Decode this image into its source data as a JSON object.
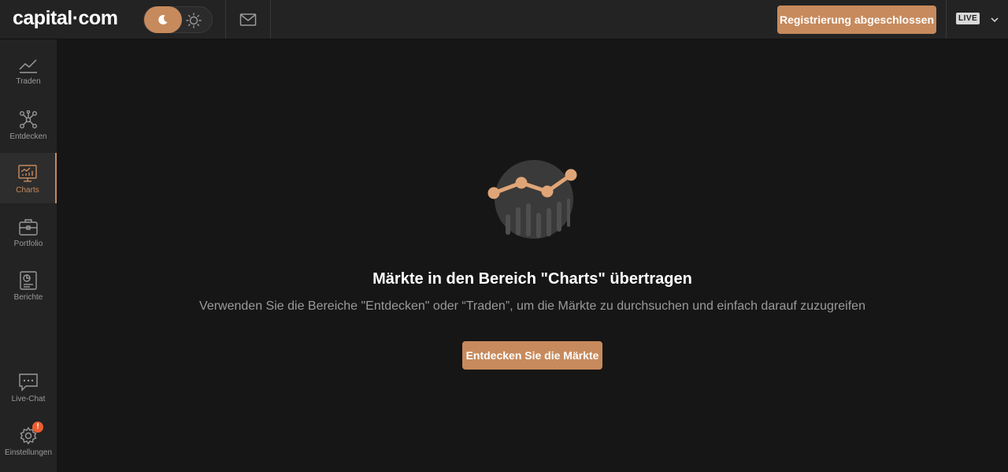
{
  "header": {
    "logo": "capital·com",
    "register_label": "Registrierung abgeschlossen",
    "account_mode": "LIVE"
  },
  "sidebar": {
    "items": [
      {
        "label": "Traden",
        "icon": "trend-icon"
      },
      {
        "label": "Entdecken",
        "icon": "network-icon"
      },
      {
        "label": "Charts",
        "icon": "chart-monitor-icon",
        "active": true
      },
      {
        "label": "Portfolio",
        "icon": "briefcase-icon"
      },
      {
        "label": "Berichte",
        "icon": "report-icon"
      },
      {
        "label": "Live-Chat",
        "icon": "chat-icon"
      },
      {
        "label": "Einstellungen",
        "icon": "gear-icon",
        "badge": "!"
      }
    ]
  },
  "main": {
    "title": "Märkte in den Bereich \"Charts\" übertragen",
    "subtitle": "Verwenden Sie die Bereiche \"Entdecken\" oder “Traden”, um die Märkte zu durchsuchen und einfach darauf zuzugreifen",
    "cta_label": "Entdecken Sie die Märkte"
  },
  "colors": {
    "accent": "#c78a5c",
    "background": "#161616",
    "panel": "#232323",
    "badge": "#ef5c2e"
  }
}
